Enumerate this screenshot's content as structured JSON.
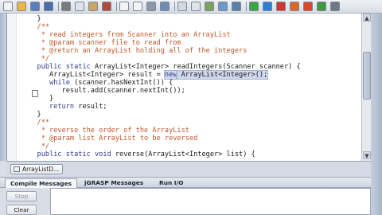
{
  "toolbar": {
    "buttons": [
      {
        "icon": "new-file-icon",
        "color": "#f2f2f2"
      },
      {
        "icon": "open-folder-icon",
        "color": "#e8b84a"
      },
      {
        "icon": "save-icon",
        "color": "#5a7fb8"
      },
      {
        "icon": "save-all-icon",
        "color": "#4b6ea8"
      },
      {
        "icon": "cut-icon",
        "color": "#7a7a7a"
      },
      {
        "icon": "copy-icon",
        "color": "#dfe4ea"
      },
      {
        "icon": "paste-icon",
        "color": "#c9a56a"
      },
      {
        "icon": "undo-icon",
        "color": "#b14b3f"
      },
      {
        "icon": "page-icon",
        "color": "#f4f4f4"
      },
      {
        "icon": "page-icon",
        "color": "#f4f4f4"
      },
      {
        "icon": "print-icon",
        "color": "#8e97a4"
      },
      {
        "icon": "browse-icon",
        "color": "#6f8cb3"
      },
      {
        "icon": "cursor-icon",
        "color": "#d4d8e0"
      },
      {
        "icon": "find-icon",
        "color": "#dfe4ea"
      },
      {
        "icon": "csd-icon",
        "color": "#7aa35b"
      },
      {
        "icon": "uml-icon",
        "color": "#6e98c7"
      },
      {
        "icon": "book-icon",
        "color": "#5b7fa6"
      },
      {
        "icon": "compile-icon",
        "color": "#3ca642"
      },
      {
        "icon": "run-icon",
        "color": "#2f7fd0"
      },
      {
        "icon": "debug-icon",
        "color": "#c93a2f"
      },
      {
        "icon": "step-icon",
        "color": "#d66a2a"
      },
      {
        "icon": "interactions-icon",
        "color": "#d84a2e"
      },
      {
        "icon": "object-workbench-icon",
        "color": "#3f9a3f"
      },
      {
        "icon": "stop-icon",
        "color": "#6f7885"
      }
    ]
  },
  "editor": {
    "lines": [
      [
        {
          "t": "   }",
          "c": ""
        }
      ],
      [
        {
          "t": "   /**",
          "c": "cm"
        }
      ],
      [
        {
          "t": "    * read integers from Scanner into an ArrayList",
          "c": "cm"
        }
      ],
      [
        {
          "t": "    * @param scanner file to read from",
          "c": "cm"
        }
      ],
      [
        {
          "t": "    * @return an ArrayList holding all of the integers",
          "c": "cm"
        }
      ],
      [
        {
          "t": "    */",
          "c": "cm"
        }
      ],
      [
        {
          "t": "   ",
          "c": ""
        },
        {
          "t": "public static",
          "c": "kw"
        },
        {
          "t": " ArrayList<Integer> readIntegers(Scanner scanner) {",
          "c": ""
        }
      ],
      [
        {
          "t": "      ArrayList<Integer> result = ",
          "c": ""
        },
        {
          "t": "new",
          "c": "kw hl"
        },
        {
          "t": " ArrayList<Integer>();",
          "c": "hl"
        }
      ],
      [
        {
          "t": "      ",
          "c": ""
        },
        {
          "t": "while",
          "c": "kw"
        },
        {
          "t": " (scanner.hasNextInt()) {",
          "c": ""
        }
      ],
      [
        {
          "t": "         result.add(scanner.nextInt());",
          "c": ""
        }
      ],
      [
        {
          "t": "      }",
          "c": ""
        }
      ],
      [
        {
          "t": "      ",
          "c": ""
        },
        {
          "t": "return",
          "c": "kw"
        },
        {
          "t": " result;",
          "c": ""
        }
      ],
      [
        {
          "t": "   }",
          "c": ""
        }
      ],
      [
        {
          "t": "   /**",
          "c": "cm"
        }
      ],
      [
        {
          "t": "    * reverse the order of the ArrayList",
          "c": "cm"
        }
      ],
      [
        {
          "t": "    * @param list ArrayList to be reversed",
          "c": "cm"
        }
      ],
      [
        {
          "t": "    */",
          "c": "cm"
        }
      ],
      [
        {
          "t": "   ",
          "c": ""
        },
        {
          "t": "public static void",
          "c": "kw"
        },
        {
          "t": " reverse(ArrayList<Integer> list) {",
          "c": ""
        }
      ]
    ]
  },
  "file_tab": {
    "label": "ArrayListD..."
  },
  "messages": {
    "tabs": [
      {
        "label": "Compile Messages",
        "active": true
      },
      {
        "label": "jGRASP Messages",
        "active": false
      },
      {
        "label": "Run I/O",
        "active": false
      }
    ],
    "stop_label": "Stop",
    "clear_label": "Clear"
  }
}
